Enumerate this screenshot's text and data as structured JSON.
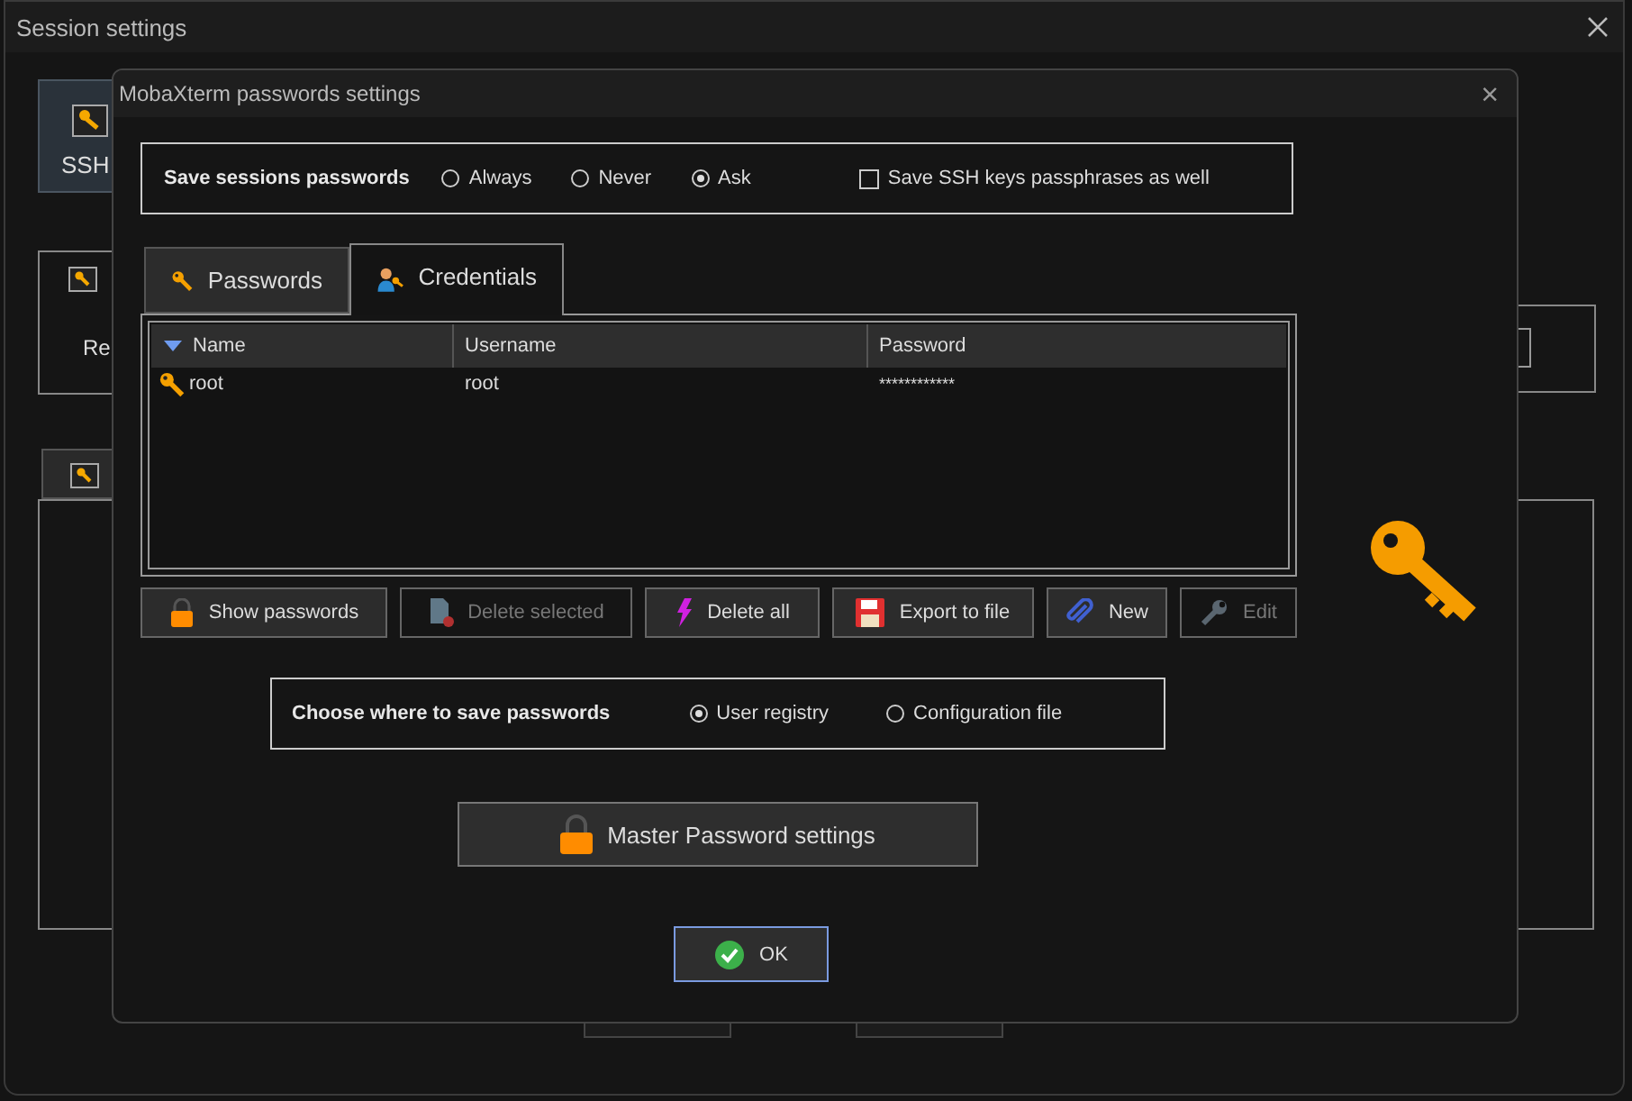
{
  "background_window": {
    "title": "Session settings",
    "tile_label": "SSH",
    "field_label": "Re"
  },
  "dialog": {
    "title": "MobaXterm passwords settings",
    "close": "×"
  },
  "save_passwords": {
    "label": "Save sessions passwords",
    "options": [
      {
        "label": "Always",
        "selected": false
      },
      {
        "label": "Never",
        "selected": false
      },
      {
        "label": "Ask",
        "selected": true
      }
    ],
    "ssh_keys": {
      "label": "Save SSH keys passphrases as well",
      "checked": false
    }
  },
  "tabs": [
    {
      "label": "Passwords",
      "selected": false
    },
    {
      "label": "Credentials",
      "selected": true
    }
  ],
  "table": {
    "columns": [
      "Name",
      "Username",
      "Password"
    ],
    "rows": [
      {
        "name": "root",
        "username": "root",
        "password": "************"
      }
    ]
  },
  "buttons": [
    {
      "label": "Show passwords",
      "disabled": false
    },
    {
      "label": "Delete selected",
      "disabled": true
    },
    {
      "label": "Delete all",
      "disabled": false
    },
    {
      "label": "Export to file",
      "disabled": false
    },
    {
      "label": "New",
      "disabled": false
    },
    {
      "label": "Edit",
      "disabled": true
    }
  ],
  "storage": {
    "label": "Choose where to save passwords",
    "options": [
      {
        "label": "User registry",
        "selected": true
      },
      {
        "label": "Configuration file",
        "selected": false
      }
    ]
  },
  "master_button": "Master Password settings",
  "ok_button": "OK"
}
